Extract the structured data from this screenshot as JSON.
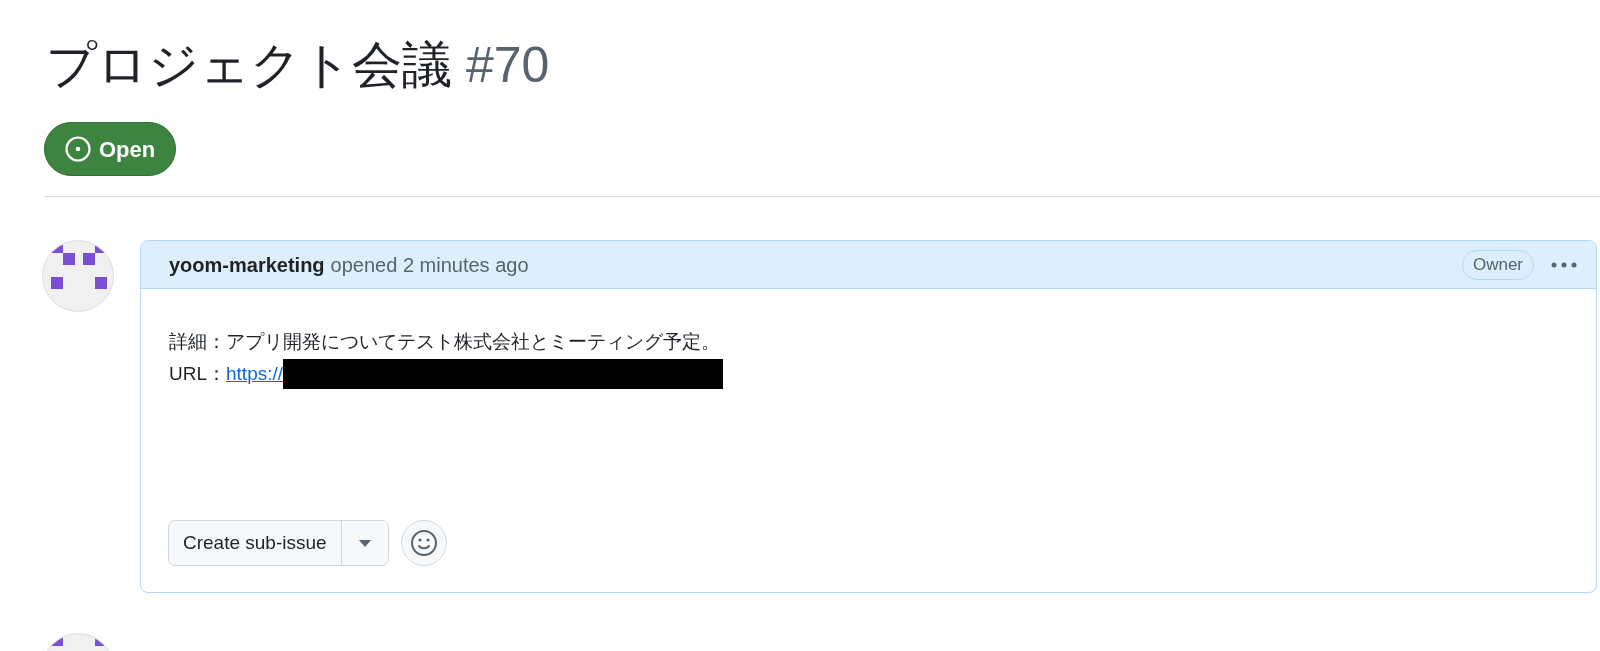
{
  "issue": {
    "title": "プロジェクト会議",
    "number": "#70",
    "status": {
      "kind": "open",
      "label": "Open"
    }
  },
  "comment": {
    "author": "yoom-marketing",
    "action": "opened 2 minutes ago",
    "role": "Owner",
    "body": {
      "detail": "詳細：アプリ開発についてテスト株式会社とミーティング予定。",
      "url_label": "URL：",
      "url_text": "https://",
      "redacted": true
    },
    "buttons": {
      "primary": "Create sub-issue"
    }
  }
}
